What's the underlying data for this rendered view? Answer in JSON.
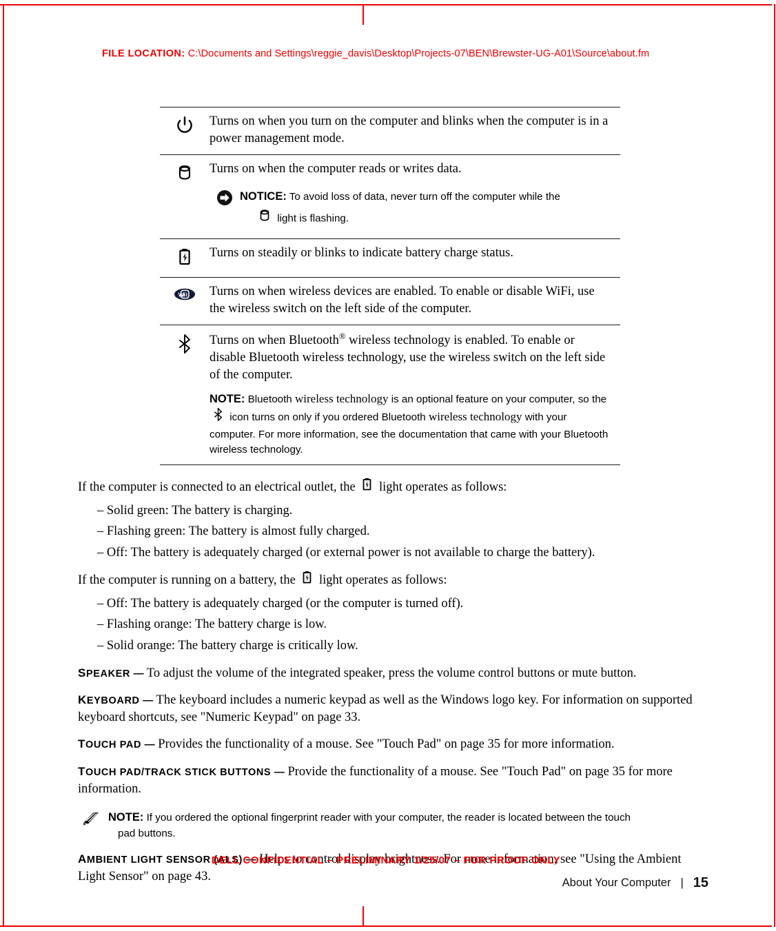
{
  "header": {
    "file_location_label": "FILE LOCATION:",
    "file_location_path": "C:\\Documents and Settings\\reggie_davis\\Desktop\\Projects-07\\BEN\\Brewster-UG-A01\\Source\\about.fm"
  },
  "colors": {
    "accent_red": "#ee0000",
    "text_black": "#000000",
    "rule_gray": "#1a1a1a"
  },
  "light_table": {
    "rows": [
      {
        "icon": "power-icon",
        "description": "Turns on when you turn on the computer and blinks when the computer is in a power management mode."
      },
      {
        "icon": "drive-activity-icon",
        "description": "Turns on when the computer reads or writes data.",
        "notice": {
          "label": "NOTICE:",
          "text": "To avoid loss of data, never turn off the computer while the",
          "text_after_icon": "light is flashing.",
          "inline_icon": "drive-activity-icon"
        }
      },
      {
        "icon": "battery-icon",
        "description": "Turns on steadily or blinks to indicate battery charge status."
      },
      {
        "icon": "wifi-icon",
        "description": "Turns on when wireless devices are enabled. To enable or disable WiFi, use the wireless switch on the left side of the computer."
      },
      {
        "icon": "bluetooth-icon",
        "description_part1": "Turns on when Bluetooth",
        "description_sup": "®",
        "description_part2": " wireless technology is enabled. To enable or disable Bluetooth wireless technology, use the wireless switch on the left side of the computer.",
        "note": {
          "label": "NOTE:",
          "seg1": "Bluetooth ",
          "seg2_serif": "wireless technology",
          "seg3": " is an optional feature on your computer, so the",
          "inline_icon": "bluetooth-icon",
          "seg4": "icon turns on only if you ordered Bluetooth ",
          "seg5_serif": "wireless technology",
          "seg6": " with your computer. For more information, see the documentation that came with your Bluetooth wireless technology."
        }
      }
    ]
  },
  "body": {
    "ac_intro_before": "If the computer is connected to an electrical outlet, the",
    "ac_intro_after": "light operates as follows:",
    "ac_intro_icon": "battery-icon",
    "ac_bullets": [
      "– Solid green: The battery is charging.",
      "– Flashing green: The battery is almost fully charged.",
      "– Off: The battery is adequately charged (or external power is not available to charge the battery)."
    ],
    "batt_intro_before": "If the computer is running on a battery, the",
    "batt_intro_after": "light operates as follows:",
    "batt_intro_icon": "battery-icon",
    "batt_bullets": [
      "– Off: The battery is adequately charged (or the computer is turned off).",
      "– Flashing orange: The battery charge is low.",
      "– Solid orange: The battery charge is critically low."
    ]
  },
  "definitions": [
    {
      "term": "SPEAKER",
      "term_cap": "S",
      "term_rest": "PEAKER",
      "dash": "—",
      "text": "To adjust the volume of the integrated speaker, press the volume control buttons or mute button."
    },
    {
      "term": "KEYBOARD",
      "term_cap": "K",
      "term_rest": "EYBOARD",
      "dash": "—",
      "text": "The keyboard includes a numeric keypad as well as the Windows logo key. For information on supported keyboard shortcuts, see \"Numeric Keypad\" on page 33."
    },
    {
      "term": "TOUCH PAD",
      "term_cap": "T",
      "term_rest": "OUCH PAD",
      "dash": "—",
      "text": "Provides the functionality of a mouse. See \"Touch Pad\" on page 35 for more information."
    },
    {
      "term": "TOUCH PAD/TRACK STICK BUTTONS",
      "term_cap": "T",
      "term_rest": "OUCH PAD/TRACK STICK BUTTONS",
      "dash": "—",
      "text": "Provide the functionality of a mouse. See \"Touch Pad\" on page 35 for more information."
    },
    {
      "term": "AMBIENT LIGHT SENSOR (ALS)",
      "term_cap": "A",
      "term_rest": "MBIENT LIGHT SENSOR (ALS)",
      "dash": "—",
      "text": "Helps to control display brightness. For more information, see \"Using the Ambient Light Sensor\" on page 43."
    }
  ],
  "standalone_note": {
    "icon": "note-pencil-icon",
    "label": "NOTE:",
    "text": "If you ordered the optional fingerprint reader with your computer, the reader is located between the touch",
    "text_cont": "pad buttons."
  },
  "footer": {
    "confidential": "DELL CONFIDENTIAL – PRELIMINARY 1/25/07 – FOR PROOF ONLY",
    "chapter": "About Your Computer",
    "separator": "|",
    "page_number": "15"
  }
}
